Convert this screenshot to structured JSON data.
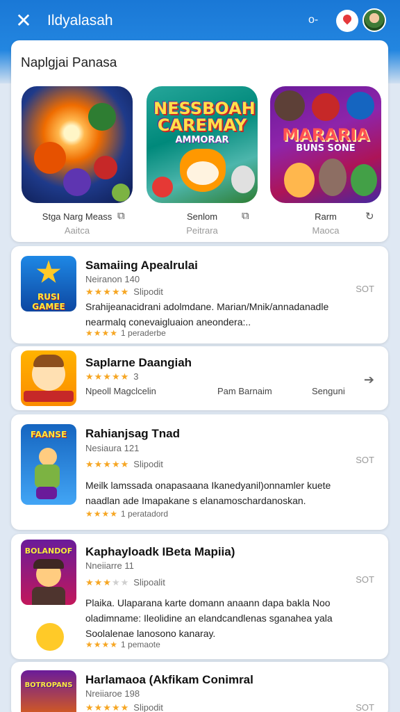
{
  "header": {
    "title": "Ildyalasah",
    "key_icon": "key-icon",
    "close_icon": "close-icon"
  },
  "featured": {
    "title": "Naplgjai Panasa",
    "tiles": [
      {
        "name": "Stga Narg Meass",
        "sub": "Aaitca",
        "logo": "",
        "logo_sub": "",
        "icon": "open-icon"
      },
      {
        "name": "Senlom",
        "sub": "Peitrara",
        "logo": "NESSBOAH CAREMAY",
        "logo_sub": "AMMORAR",
        "icon": "open-icon"
      },
      {
        "name": "Rarm",
        "sub": "Maoca",
        "logo": "MARARIA",
        "logo_sub": "BUNS SONE",
        "icon": "share-icon"
      }
    ]
  },
  "apps": [
    {
      "name": "Samaiing Apealrulai",
      "meta": "Neiranon 140",
      "stars": 5,
      "rating_text": "Slipodit",
      "desc": "Srahijeanacidrani adolmdane. Marian/Mnik/annadanadle nearmalq conevaigluaion aneondera:..",
      "small_stars": 4,
      "small_text": "1 peraderbe",
      "side": "SOT",
      "icon_text": "RUSI GAMEE"
    },
    {
      "name": "Saplarne Daangiah",
      "meta": "",
      "stars": 5,
      "rating_text": "3",
      "desc_left": "Npeoll Magclcelin",
      "desc_mid": "Pam Barnaim",
      "desc_right": "Senguni",
      "side": "➔",
      "icon_text": ""
    },
    {
      "name": "Rahianjsag Tnad",
      "meta": "Nesiaura 121",
      "stars": 5,
      "rating_text": "Slipodit",
      "desc": "Meilk lamssada onapasaana Ikanedyanil)onnamler kuete naadlan ade Imapakane s elanamoschardanoskan.",
      "small_stars": 4,
      "small_text": "1 peratadord",
      "side": "SOT",
      "icon_text": "FAANSE"
    },
    {
      "name": "Kaphayloadk IBeta Mapiia)",
      "meta": "Nneiiarre 11",
      "stars": 3,
      "rating_text": "Slipoalit",
      "desc": "Plaika. Ulaparana karte domann anaann dapa bakla Noo oladimname: Ileolidine an elandcandlenas sganahea yala Soolalenae lanosono kanaray.",
      "small_stars": 4,
      "small_text": "1 pemaote",
      "side": "SOT",
      "icon_text": "BOLANDOF"
    },
    {
      "name": "Harlamaoa (Akfikam Conimral",
      "meta": "Nreiiaroe 198",
      "stars": 5,
      "rating_text": "Slipodit",
      "side": "SOT",
      "icon_text": "BOTROPANS"
    }
  ]
}
